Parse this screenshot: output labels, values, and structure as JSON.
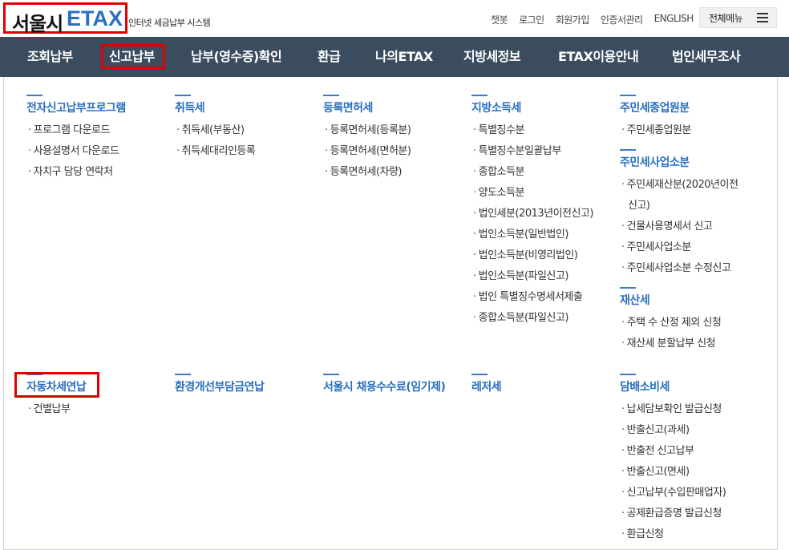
{
  "header": {
    "logo_seoul": "서울시",
    "logo_etax": "ETAX",
    "logo_sub": "인터넷 세금납부 시스템",
    "top_links": [
      "챗봇",
      "로그인",
      "회원가입",
      "인증서관리",
      "ENGLISH"
    ],
    "all_menu_label": "전체메뉴"
  },
  "nav": {
    "items": [
      "조회납부",
      "신고납부",
      "납부(영수증)확인",
      "환급",
      "나의ETAX",
      "지방세정보",
      "ETAX이용안내",
      "법인세무조사"
    ],
    "active": "신고납부"
  },
  "menu": {
    "col1": [
      {
        "title": "전자신고납부프로그램",
        "items": [
          "프로그램 다운로드",
          "사용설명서 다운로드",
          "자치구 담당 연락처"
        ]
      }
    ],
    "col2": [
      {
        "title": "취득세",
        "items": [
          "취득세(부동산)",
          "취득세대리인등록"
        ]
      }
    ],
    "col3": [
      {
        "title": "등록면허세",
        "items": [
          "등록면허세(등록분)",
          "등록면허세(면허분)",
          "등록면허세(차량)"
        ]
      }
    ],
    "col4": [
      {
        "title": "지방소득세",
        "items": [
          "특별징수분",
          "특별징수분일괄납부",
          "종합소득분",
          "양도소득분",
          "법인세분(2013년이전신고)",
          "법인소득분(일반법인)",
          "법인소득분(비영리법인)",
          "법인소득분(파일신고)",
          "법인 특별징수명세서제출",
          "종합소득분(파일신고)"
        ]
      }
    ],
    "col5": [
      {
        "title": "주민세종업원분",
        "items": [
          "주민세종업원분"
        ]
      },
      {
        "title": "주민세사업소분",
        "items": [
          "주민세재산분(2020년이전",
          "건물사용명세서 신고",
          "주민세사업소분",
          "주민세사업소분 수정신고"
        ],
        "continuation": "신고)"
      },
      {
        "title": "재산세",
        "items": [
          "주택 수 산정 제외 신청",
          "재산세 분할납부 신청"
        ]
      }
    ],
    "row2": {
      "col1": {
        "title": "자동차세연납",
        "items": [
          "건별납부"
        ]
      },
      "col2": {
        "title": "환경개선부담금연납",
        "items": []
      },
      "col3": {
        "title": "서울시 채용수수료(임기제)",
        "items": []
      },
      "col4": {
        "title": "레저세",
        "items": []
      },
      "col5": {
        "title": "담배소비세",
        "items": [
          "납세담보확인 발급신청",
          "반출신고(과세)",
          "반출전 신고납부",
          "반출신고(면세)",
          "신고납부(수입판매업자)",
          "공제환급증명 발급신청",
          "환급신청"
        ]
      }
    }
  },
  "colors": {
    "nav_bg": "#3c4c5f",
    "accent_blue": "#2a6fc0",
    "highlight_red": "#e00000"
  }
}
